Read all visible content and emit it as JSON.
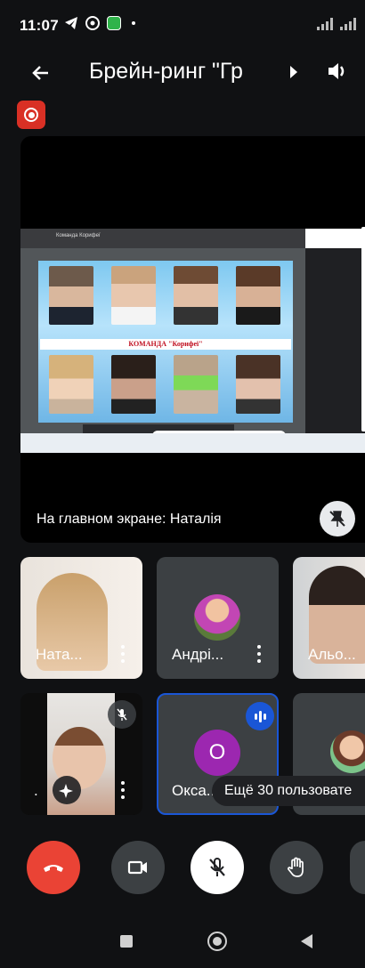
{
  "status_bar": {
    "time": "11:07",
    "icons": [
      "telegram-icon",
      "chrome-icon",
      "app-icon",
      "dot-icon"
    ],
    "signal_icons": [
      "signal-icon",
      "signal-icon"
    ]
  },
  "header": {
    "title": "Брейн-ринг \"Гр",
    "back_icon": "arrow-left-icon",
    "speaker_icon": "speaker-icon",
    "recording_icon": "record-icon",
    "colors": {
      "recording": "#d93025"
    }
  },
  "stage": {
    "caption": "На главном экране: Наталія",
    "pin_icon": "pin-off-icon",
    "shared_screen": {
      "window_title": "Команда Корифеї",
      "banner": "КОМАНДА \"Корифеї\""
    }
  },
  "participants": [
    {
      "name": "Ната...",
      "muted": false,
      "has_video": true
    },
    {
      "name": "Андрі...",
      "muted": false,
      "has_video": false
    },
    {
      "name": "Альо...",
      "muted": false,
      "has_video": true
    },
    {
      "name": ".",
      "muted": true,
      "has_video": true,
      "effect_icon": "sparkle-icon"
    },
    {
      "name": "Окса...",
      "initial": "О",
      "speaking": true,
      "has_video": false
    },
    {
      "name": "",
      "has_video": false
    }
  ],
  "more_participants": "Ещё 30 пользовате",
  "controls": {
    "end_call_icon": "phone-hangup-icon",
    "camera_icon": "camera-icon",
    "mic_icon": "mic-off-icon",
    "hand_icon": "raise-hand-icon",
    "colors": {
      "end_call": "#ea4335",
      "accent": "#1a56d6",
      "avatar_purple": "#9c27b0"
    }
  },
  "nav_bar": {
    "icons": [
      "square-icon",
      "circle-icon",
      "back-triangle-icon"
    ]
  }
}
